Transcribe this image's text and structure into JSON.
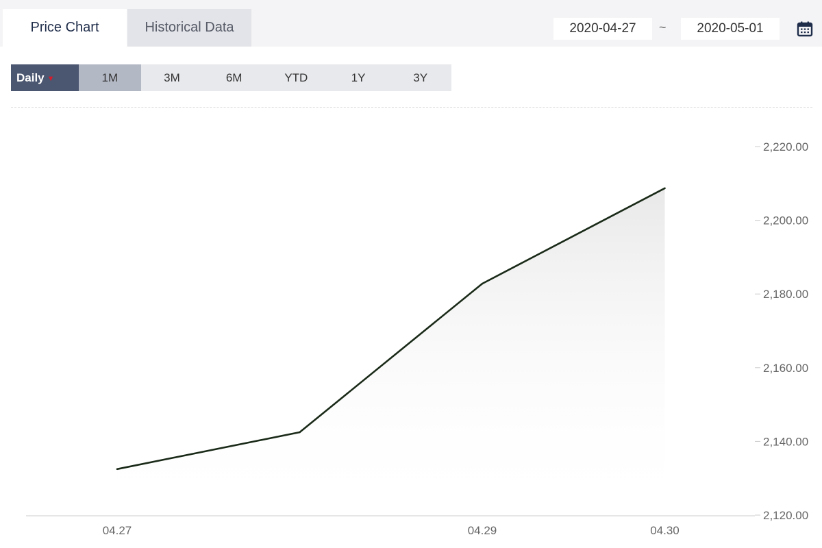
{
  "tabs": [
    {
      "label": "Price Chart",
      "active": true
    },
    {
      "label": "Historical Data",
      "active": false
    }
  ],
  "date_range": {
    "start": "2020-04-27",
    "separator": "~",
    "end": "2020-05-01"
  },
  "frequency": {
    "label": "Daily",
    "caret": "▼"
  },
  "periods": [
    {
      "label": "1M",
      "selected": true
    },
    {
      "label": "3M",
      "selected": false
    },
    {
      "label": "6M",
      "selected": false
    },
    {
      "label": "YTD",
      "selected": false
    },
    {
      "label": "1Y",
      "selected": false
    },
    {
      "label": "3Y",
      "selected": false
    }
  ],
  "icons": {
    "calendar": "calendar-icon"
  },
  "colors": {
    "line": "#1a2a18",
    "accent": "#4b5670",
    "caret": "#d81b2a"
  },
  "chart_data": {
    "type": "area",
    "x": [
      "2020-04-27",
      "2020-04-28",
      "2020-04-29",
      "2020-04-30"
    ],
    "values": [
      2132.5,
      2142.5,
      2182.8,
      2208.7
    ],
    "x_tick_labels": [
      {
        "x": "2020-04-27",
        "label": "04.27"
      },
      {
        "x": "2020-04-29",
        "label": "04.29"
      },
      {
        "x": "2020-04-30",
        "label": "04.30"
      }
    ],
    "y_ticks": [
      2120,
      2140,
      2160,
      2180,
      2200,
      2220
    ],
    "y_tick_labels": [
      "2,120.00",
      "2,140.00",
      "2,160.00",
      "2,180.00",
      "2,200.00",
      "2,220.00"
    ],
    "ylim": [
      2120,
      2220
    ],
    "grid": false,
    "y_axis_side": "right"
  }
}
